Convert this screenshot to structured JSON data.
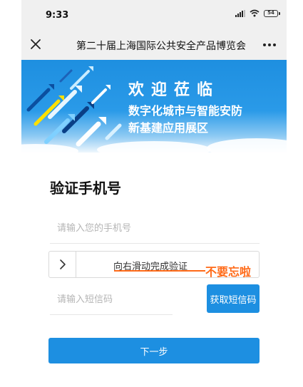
{
  "status_bar": {
    "time": "9:33",
    "battery": "54"
  },
  "nav": {
    "title": "第二十届上海国际公共安全产品博览会",
    "close_icon": "close-icon",
    "more_icon": "more-icon"
  },
  "banner": {
    "line1": "欢迎莅临",
    "line2": "数字化城市与智能安防",
    "line3": "新基建应用展区"
  },
  "form": {
    "title": "验证手机号",
    "phone_placeholder": "请输入您的手机号",
    "slider_text": "向右滑动完成验证",
    "sms_placeholder": "请输入短信码",
    "sms_button": "获取短信码",
    "next_button": "下一步"
  },
  "annotation": {
    "text": "不要忘啦"
  },
  "colors": {
    "accent": "#1d8fe1",
    "annotation": "#ff6a18",
    "bar_background": "#f0f0f0"
  }
}
